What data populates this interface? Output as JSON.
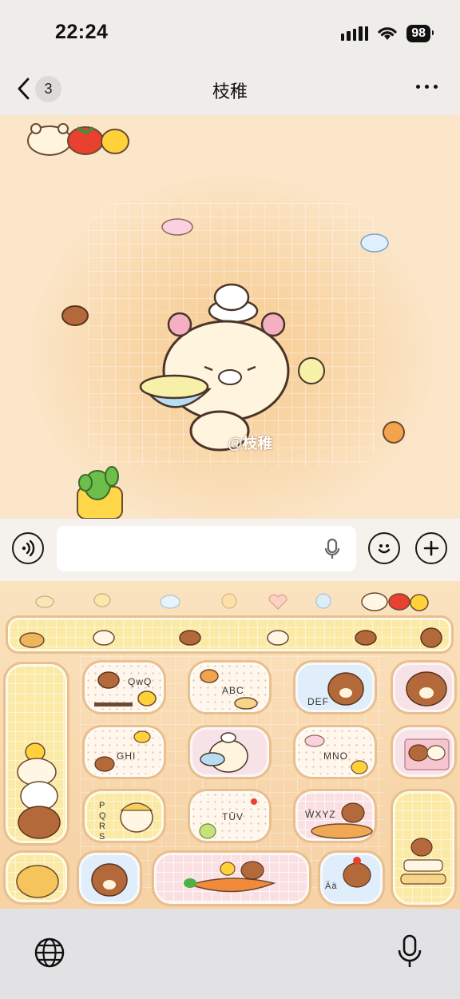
{
  "status_bar": {
    "time": "22:24",
    "battery": "98"
  },
  "nav": {
    "back_count": "3",
    "title": "枝稚"
  },
  "chat": {
    "watermark": "@枝稚"
  },
  "composer": {
    "placeholder": ""
  },
  "keyboard": {
    "keys": [
      {
        "name": "key-punct",
        "label": ""
      },
      {
        "name": "key-abc",
        "label": "ABC"
      },
      {
        "name": "key-def",
        "label": "DEF"
      },
      {
        "name": "key-qwq",
        "label": "QwQ"
      },
      {
        "name": "key-ghi",
        "label": "GHI"
      },
      {
        "name": "key-jkl",
        "label": ""
      },
      {
        "name": "key-mno",
        "label": "MNO"
      },
      {
        "name": "key-pqrs",
        "label": "PQRS"
      },
      {
        "name": "key-tuv",
        "label": "TŪV"
      },
      {
        "name": "key-wxyz",
        "label": "ŴXYZ"
      },
      {
        "name": "key-lang",
        "label": "Ää"
      }
    ]
  },
  "colors": {
    "keyboard_bg": "#f8d7ad",
    "key_border": "#e9bf8d",
    "chat_bg": "#f9d8ab"
  }
}
